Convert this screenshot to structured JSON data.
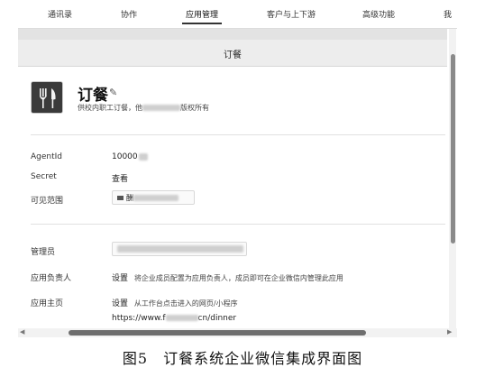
{
  "nav": {
    "tabs": [
      {
        "label": "通讯录"
      },
      {
        "label": "协作"
      },
      {
        "label": "应用管理"
      },
      {
        "label": "客户与上下游"
      },
      {
        "label": "高级功能"
      },
      {
        "label": "我"
      }
    ],
    "active_index": 2
  },
  "page_title": "订餐",
  "app": {
    "name": "订餐",
    "description_prefix": "供校内职工订餐，",
    "description_partial": "他",
    "description_suffix": "版权所有"
  },
  "fields": {
    "agentid_label": "AgentId",
    "agentid_value": "10000",
    "secret_label": "Secret",
    "secret_action": "查看",
    "visible_label": "可见范围",
    "visible_partial": "酬",
    "admin_label": "管理员",
    "owner_label": "应用负责人",
    "owner_action": "设置",
    "owner_hint": "将企业成员配置为应用负责人，成员即可在企业微信内管理此应用",
    "homepage_label": "应用主页",
    "homepage_action": "设置",
    "homepage_hint": "从工作台点击进入的网页/小程序",
    "homepage_url_prefix": "https://www.f",
    "homepage_url_suffix": "cn/dinner"
  },
  "caption": "图5　订餐系统企业微信集成界面图",
  "colors": {
    "active_underline": "#333333",
    "title_bar_bg": "#ededed",
    "scroll_thumb": "#6e6e6e"
  }
}
